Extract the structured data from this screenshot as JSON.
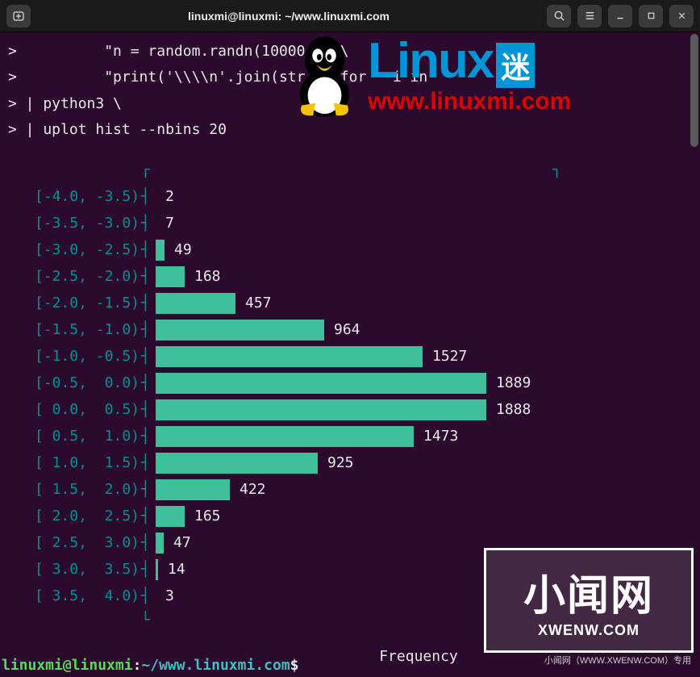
{
  "titlebar": {
    "title": "linuxmi@linuxmi: ~/www.linuxmi.com"
  },
  "code": {
    "line1": ">          \"n = random.randn(10000    \\",
    "line2": ">          \"print('\\\\\\\\n'.join(str    for   i in         \\",
    "line3": "> | python3 \\",
    "line4": "> | uplot hist --nbins 20"
  },
  "chart_data": {
    "type": "bar",
    "orientation": "horizontal",
    "title": "",
    "xlabel": "Frequency",
    "ylabel": "",
    "xlim": [
      0,
      1900
    ],
    "categories": [
      "[-4.0, -3.5)",
      "[-3.5, -3.0)",
      "[-3.0, -2.5)",
      "[-2.5, -2.0)",
      "[-2.0, -1.5)",
      "[-1.5, -1.0)",
      "[-1.0, -0.5)",
      "[-0.5,  0.0)",
      "[ 0.0,  0.5)",
      "[ 0.5,  1.0)",
      "[ 1.0,  1.5)",
      "[ 1.5,  2.0)",
      "[ 2.0,  2.5)",
      "[ 2.5,  3.0)",
      "[ 3.0,  3.5)",
      "[ 3.5,  4.0)"
    ],
    "values": [
      2,
      7,
      49,
      168,
      457,
      964,
      1527,
      1889,
      1888,
      1473,
      925,
      422,
      165,
      47,
      14,
      3
    ]
  },
  "logo": {
    "word": "Linux",
    "mi": "迷",
    "url": "www.linuxmi.com"
  },
  "watermark": {
    "cn": "小闻网",
    "en": "XWENW.COM",
    "sub": "小闻网（WWW.XWENW.COM）专用"
  },
  "prompt": {
    "user": "linuxmi",
    "at": "@",
    "host": "linuxmi",
    "colon": ":",
    "path": "~/www.linuxmi.com",
    "dollar": "$"
  },
  "freq_label": "Frequency"
}
